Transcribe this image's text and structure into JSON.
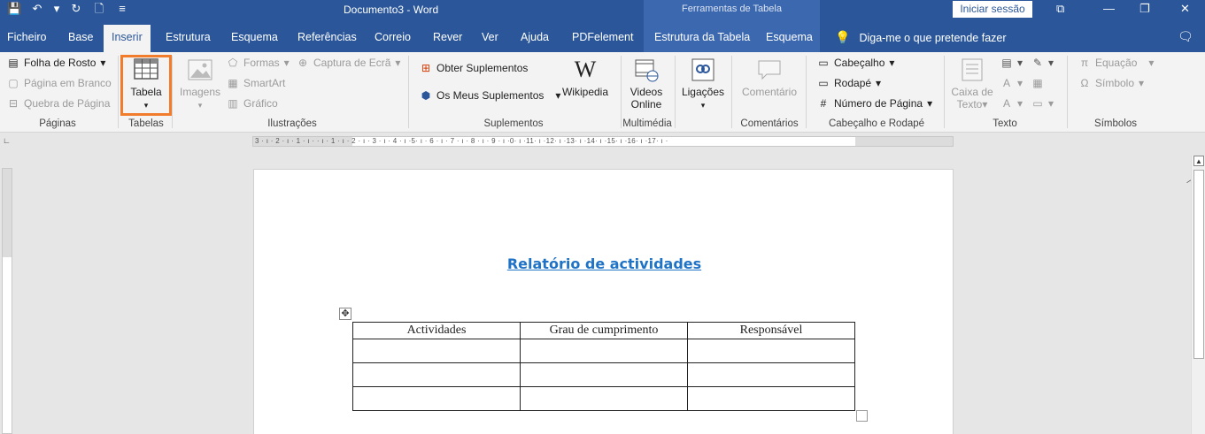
{
  "window": {
    "doc_title": "Documento3  -  Word",
    "contextual_title": "Ferramentas de Tabela",
    "sign_in": "Iniciar sessão"
  },
  "qat": {
    "save": "💾",
    "undo": "↶",
    "undo_dropdown": "▾",
    "redo": "↻",
    "new": "🗋",
    "customize": "≡"
  },
  "tabs": [
    "Ficheiro",
    "Base",
    "Inserir",
    "Estrutura",
    "Esquema",
    "Referências",
    "Correio",
    "Rever",
    "Ver",
    "Ajuda",
    "PDFelement"
  ],
  "active_tab": "Inserir",
  "context_tabs": [
    "Estrutura da Tabela",
    "Esquema"
  ],
  "tell_me": "Diga-me o que pretende fazer",
  "ribbon": {
    "paginas": {
      "label": "Páginas",
      "items": [
        "Folha de Rosto",
        "Página em Branco",
        "Quebra de Página"
      ]
    },
    "tabelas": {
      "label": "Tabelas",
      "button": "Tabela"
    },
    "ilustracoes": {
      "label": "Ilustrações",
      "imagens": "Imagens",
      "formas": "Formas",
      "smartart": "SmartArt",
      "grafico": "Gráfico",
      "captura": "Captura de Ecrã"
    },
    "suplementos": {
      "label": "Suplementos",
      "obter": "Obter Suplementos",
      "meus": "Os Meus Suplementos",
      "wikipedia": "Wikipedia"
    },
    "multimedia": {
      "label": "Multimédia",
      "videos": "Videos",
      "online": "Online"
    },
    "ligacoes": {
      "label": "Ligações"
    },
    "comentarios": {
      "label": "Comentários",
      "button": "Comentário"
    },
    "cabecalho": {
      "label": "Cabeçalho e Rodapé",
      "cabecalho": "Cabeçalho",
      "rodape": "Rodapé",
      "numero": "Número de Página"
    },
    "texto": {
      "label": "Texto",
      "caixa1": "Caixa de",
      "caixa2": "Texto"
    },
    "simbolos": {
      "label": "Símbolos",
      "equacao": "Equação",
      "simbolo": "Símbolo"
    }
  },
  "ruler": {
    "ticks": "3 · ı · 2 · ı · 1 · ı ·  · ı · 1 · ı · 2 · ı · 3 · ı · 4 · ı ·5· ı · 6 · ı · 7 · ı · 8 · ı · 9 · ı ·0· ı ·11· ı ·12· ı ·13· ı ·14· ı ·15· ı ·16· ı ·17· ı ·"
  },
  "document": {
    "heading": "Relatório de actividades",
    "table_headers": [
      "Actividades",
      "Grau de cumprimento",
      "Responsável"
    ],
    "table_rows": [
      [
        "",
        "",
        ""
      ],
      [
        "",
        "",
        ""
      ],
      [
        "",
        "",
        ""
      ]
    ]
  },
  "colors": {
    "accent": "#2b579a",
    "highlight": "#f07c2c",
    "heading": "#1f73c7"
  }
}
